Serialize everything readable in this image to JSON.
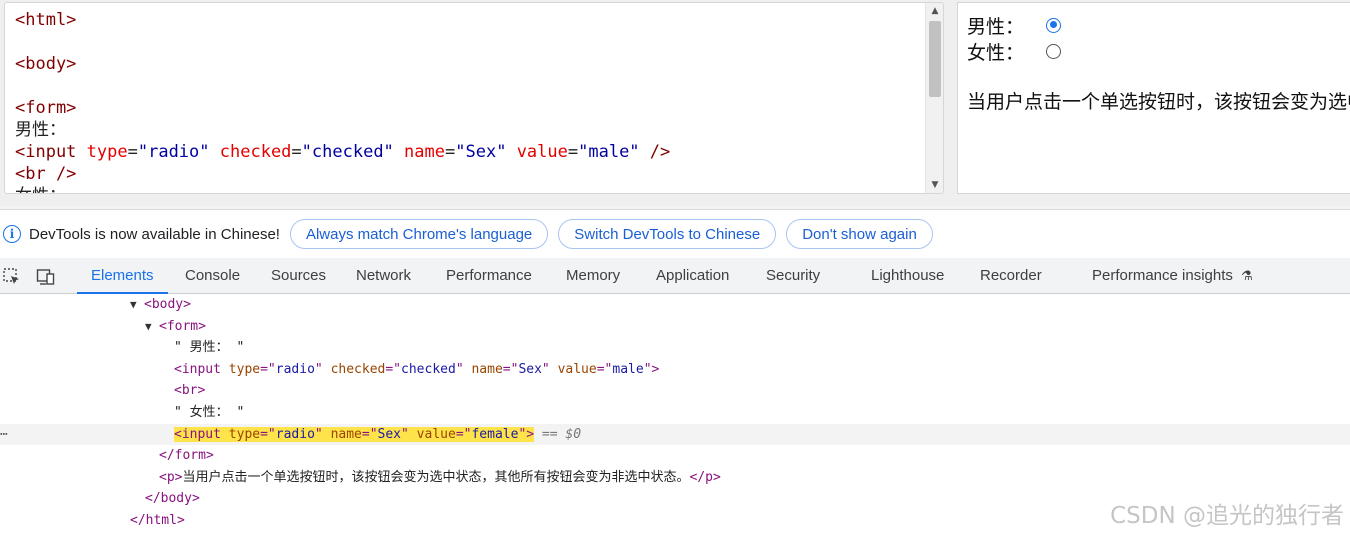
{
  "editor": {
    "lines": [
      [
        {
          "c": "tag",
          "t": "<html>"
        }
      ],
      [],
      [
        {
          "c": "tag",
          "t": "<body>"
        }
      ],
      [],
      [
        {
          "c": "tag",
          "t": "<form>"
        }
      ],
      [
        {
          "c": "txt",
          "t": "男性："
        }
      ],
      [
        {
          "c": "tag",
          "t": "<input "
        },
        {
          "c": "attr",
          "t": "type"
        },
        {
          "c": "txt",
          "t": "="
        },
        {
          "c": "val",
          "t": "\"radio\""
        },
        {
          "c": "txt",
          "t": " "
        },
        {
          "c": "attr",
          "t": "checked"
        },
        {
          "c": "txt",
          "t": "="
        },
        {
          "c": "val",
          "t": "\"checked\""
        },
        {
          "c": "txt",
          "t": " "
        },
        {
          "c": "attr",
          "t": "name"
        },
        {
          "c": "txt",
          "t": "="
        },
        {
          "c": "val",
          "t": "\"Sex\""
        },
        {
          "c": "txt",
          "t": " "
        },
        {
          "c": "attr",
          "t": "value"
        },
        {
          "c": "txt",
          "t": "="
        },
        {
          "c": "val",
          "t": "\"male\""
        },
        {
          "c": "tag",
          "t": " />"
        }
      ],
      [
        {
          "c": "tag",
          "t": "<br />"
        }
      ],
      [
        {
          "c": "txt",
          "t": "女性："
        }
      ]
    ]
  },
  "preview": {
    "male_label": "男性：",
    "female_label": "女性：",
    "paragraph": "当用户点击一个单选按钮时，该按钮会变为选中状态，其他所有按钮会变为非选中状态。"
  },
  "infobar": {
    "message": "DevTools is now available in Chinese!",
    "btn_match": "Always match Chrome's language",
    "btn_switch": "Switch DevTools to Chinese",
    "btn_dismiss": "Don't show again"
  },
  "tabs": {
    "elements": "Elements",
    "console": "Console",
    "sources": "Sources",
    "network": "Network",
    "performance": "Performance",
    "memory": "Memory",
    "application": "Application",
    "security": "Security",
    "lighthouse": "Lighthouse",
    "recorder": "Recorder",
    "perf_insights": "Performance insights"
  },
  "tree": {
    "rows": [
      {
        "indent": 130,
        "tri": "▼",
        "parts": [
          {
            "c": "tw",
            "t": "<body>"
          }
        ]
      },
      {
        "indent": 145,
        "tri": "▼",
        "parts": [
          {
            "c": "tw",
            "t": "<form>"
          }
        ]
      },
      {
        "indent": 174,
        "parts": [
          {
            "c": "tt",
            "t": "\" 男性： \""
          }
        ]
      },
      {
        "indent": 174,
        "parts": [
          {
            "c": "tw",
            "t": "<input "
          },
          {
            "c": "ta",
            "t": "type"
          },
          {
            "c": "tw",
            "t": "=\""
          },
          {
            "c": "tv",
            "t": "radio"
          },
          {
            "c": "tw",
            "t": "\" "
          },
          {
            "c": "ta",
            "t": "checked"
          },
          {
            "c": "tw",
            "t": "=\""
          },
          {
            "c": "tv",
            "t": "checked"
          },
          {
            "c": "tw",
            "t": "\" "
          },
          {
            "c": "ta",
            "t": "name"
          },
          {
            "c": "tw",
            "t": "=\""
          },
          {
            "c": "tv",
            "t": "Sex"
          },
          {
            "c": "tw",
            "t": "\" "
          },
          {
            "c": "ta",
            "t": "value"
          },
          {
            "c": "tw",
            "t": "=\""
          },
          {
            "c": "tv",
            "t": "male"
          },
          {
            "c": "tw",
            "t": "\">"
          }
        ]
      },
      {
        "indent": 174,
        "parts": [
          {
            "c": "tw",
            "t": "<br>"
          }
        ]
      },
      {
        "indent": 174,
        "parts": [
          {
            "c": "tt",
            "t": "\" 女性： \""
          }
        ]
      },
      {
        "indent": 174,
        "selected": true,
        "parts": [
          {
            "c": "tw hl",
            "t": "<input "
          },
          {
            "c": "ta hl",
            "t": "type"
          },
          {
            "c": "tw hl",
            "t": "=\""
          },
          {
            "c": "tv hl",
            "t": "radio"
          },
          {
            "c": "tw hl",
            "t": "\" "
          },
          {
            "c": "ta hl",
            "t": "name"
          },
          {
            "c": "tw hl",
            "t": "=\""
          },
          {
            "c": "tv hl",
            "t": "Sex"
          },
          {
            "c": "tw hl",
            "t": "\" "
          },
          {
            "c": "ta hl",
            "t": "value"
          },
          {
            "c": "tw hl",
            "t": "=\""
          },
          {
            "c": "tv hl",
            "t": "female"
          },
          {
            "c": "tw hl",
            "t": "\">"
          },
          {
            "c": "eq",
            "t": " == $0"
          }
        ]
      },
      {
        "indent": 159,
        "parts": [
          {
            "c": "tw",
            "t": "</form>"
          }
        ]
      },
      {
        "indent": 159,
        "parts": [
          {
            "c": "tw",
            "t": "<p>"
          },
          {
            "c": "tt",
            "t": "当用户点击一个单选按钮时，该按钮会变为选中状态，其他所有按钮会变为非选中状态。"
          },
          {
            "c": "tw",
            "t": "</p>"
          }
        ]
      },
      {
        "indent": 145,
        "parts": [
          {
            "c": "tw",
            "t": "</body>"
          }
        ]
      },
      {
        "indent": 130,
        "parts": [
          {
            "c": "tw",
            "t": "</html>"
          }
        ]
      }
    ]
  },
  "watermark": "CSDN @追光的独行者",
  "colors": {
    "accent": "#1a73e8",
    "highlight": "#ffe34a",
    "tag": "#881280",
    "attr": "#994500",
    "value": "#1a1aa6"
  }
}
